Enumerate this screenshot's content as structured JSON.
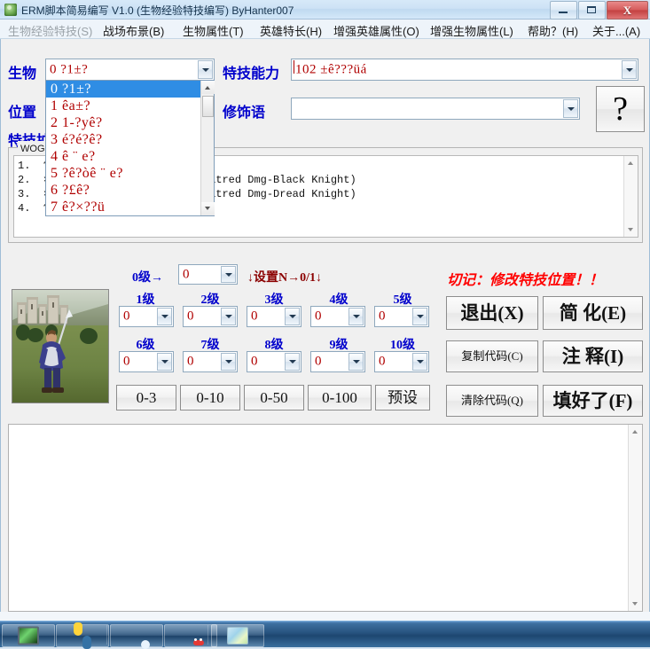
{
  "window": {
    "title": "ERM脚本简易编写 V1.0 (生物经验特技编写) ByHanter007",
    "icon": "app-icon",
    "minimize_label": "",
    "maximize_label": "",
    "close_label": "X"
  },
  "menubar": {
    "items": [
      {
        "label": "生物经验特技(S)",
        "state": "disabled"
      },
      {
        "label": "战场布景(B)",
        "state": "normal"
      },
      {
        "label": "生物属性(T)",
        "state": "normal"
      },
      {
        "label": "英雄特长(H)",
        "state": "normal"
      },
      {
        "label": "增强英雄属性(O)",
        "state": "normal"
      },
      {
        "label": "增强生物属性(L)",
        "state": "normal"
      },
      {
        "label": "帮助？(H)",
        "state": "normal"
      },
      {
        "label": "关于...(A)",
        "state": "normal"
      }
    ]
  },
  "form": {
    "creature_label": "生物",
    "creature_value": "0  ?1±?",
    "position_label": "位置",
    "skill_ext_label": "特技扩",
    "ability_label": "特技能力",
    "ability_value": "102  ±ê???üá",
    "modifier_label": "修饰语",
    "modifier_value": "",
    "help_button": "?"
  },
  "dropdown": {
    "open": true,
    "options": [
      "0  ?1±?",
      "1  êa±?",
      "2  1-?yê?",
      "3  é?é?ê?",
      "4  ê ¨ e?",
      "5  ?ê?òê ¨ e?",
      "6  ?£ê?",
      "7  ê?×??ü"
    ],
    "selected_index": 0
  },
  "groupbox": {
    "title": "WOG中…………考,以游戏显示为准)",
    "lines": [
      "1.  ??……………………………th) Attack R5)",
      "2.  ×………………………?é?o|(Pikeman: Hatred Dmg-Black Knight)",
      "3.  ×………………………?é?o|(Pikeman: Hatred Dmg-Dread Knight)",
      "4.  ??……(Pikeman: Fearless R8)"
    ]
  },
  "levels": {
    "zero_label": "0级→",
    "zero_value": "0",
    "hint": "↓设置N→0/1↓",
    "warning": "切记：修改特技位置！！",
    "rows": [
      {
        "label": "1级",
        "value": "0"
      },
      {
        "label": "2级",
        "value": "0"
      },
      {
        "label": "3级",
        "value": "0"
      },
      {
        "label": "4级",
        "value": "0"
      },
      {
        "label": "5级",
        "value": "0"
      },
      {
        "label": "6级",
        "value": "0"
      },
      {
        "label": "7级",
        "value": "0"
      },
      {
        "label": "8级",
        "value": "0"
      },
      {
        "label": "9级",
        "value": "0"
      },
      {
        "label": "10级",
        "value": "0"
      }
    ]
  },
  "range_buttons": [
    {
      "label": "0-3"
    },
    {
      "label": "0-10"
    },
    {
      "label": "0-50"
    },
    {
      "label": "0-100"
    },
    {
      "label": "预设"
    }
  ],
  "action_buttons": {
    "exit": "退出(X)",
    "simplify": "简 化(E)",
    "copy_code": "复制代码(C)",
    "annotate": "注 释(I)",
    "clear_code": "清除代码(Q)",
    "done": "填好了(F)"
  },
  "output": {
    "text": ""
  },
  "taskbar": {
    "items": [
      {
        "icon": "monitor-icon"
      },
      {
        "icon": "python-icon"
      },
      {
        "icon": "browser-icon"
      },
      {
        "icon": "qq-icon"
      },
      {
        "icon": "map-icon"
      }
    ]
  },
  "colors": {
    "label_blue": "#0000cc",
    "value_red": "#b00000",
    "warn_red": "#ff0000",
    "note_red": "#8b0000",
    "select_blue": "#2f8de4"
  }
}
